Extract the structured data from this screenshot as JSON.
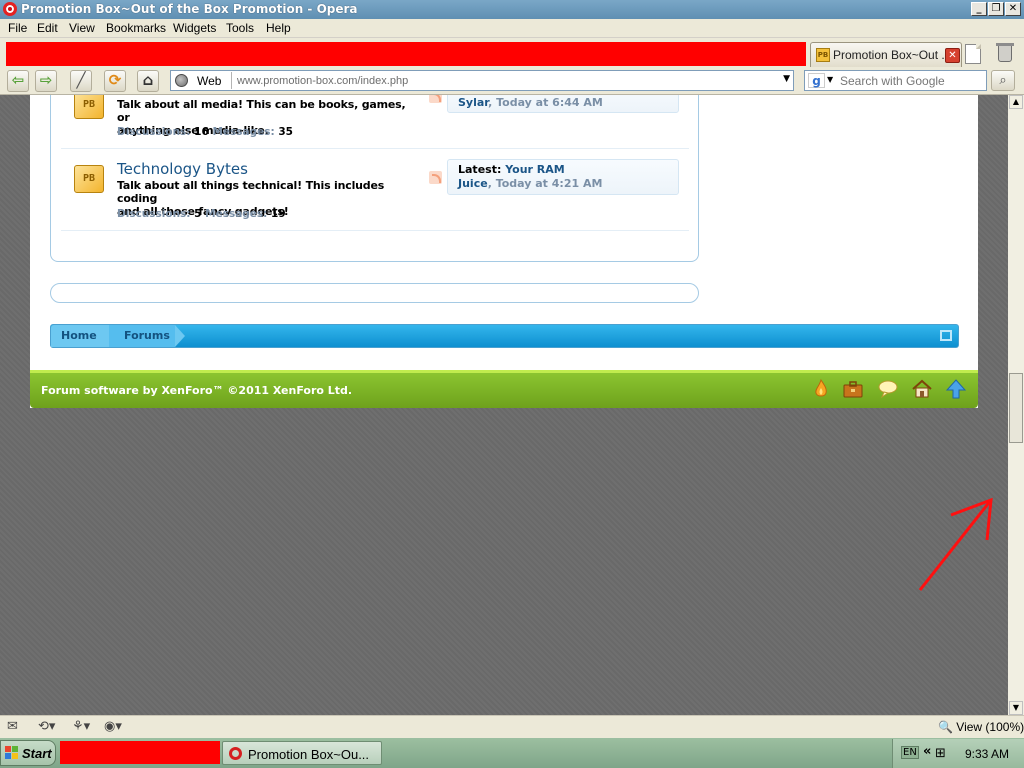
{
  "window": {
    "title": "Promotion Box~Out of the Box Promotion - Opera",
    "controls": [
      "_",
      "❐",
      "✕"
    ]
  },
  "menu": [
    "File",
    "Edit",
    "View",
    "Bookmarks",
    "Widgets",
    "Tools",
    "Help"
  ],
  "tab": {
    "label": "Promotion Box~Out ...",
    "favicon": "PB",
    "close": "✕"
  },
  "address": {
    "mode_label": "Web",
    "url": "www.promotion-box.com/index.php"
  },
  "search": {
    "placeholder": "Search with Google",
    "engine_logo": "g"
  },
  "forum": {
    "nodes": [
      {
        "icon_text": "PB",
        "title": "",
        "description_line1": "Talk about all media! This can be books, games, or",
        "description_line2": "anything else media-like.",
        "discussions_label": "Discussions:",
        "discussions": "16",
        "messages_label": "Messages:",
        "messages": "35",
        "latest_title": "",
        "latest_user": "Sylar",
        "latest_time": ", Today at 6:44 AM"
      },
      {
        "icon_text": "PB",
        "title": "Technology Bytes",
        "description_line1": "Talk about all things technical! This includes coding",
        "description_line2": "and all those fancy gadgets!",
        "discussions_label": "Discussions:",
        "discussions": "5",
        "messages_label": "Messages:",
        "messages": "19",
        "latest_label": "Latest:",
        "latest_title": "Your RAM",
        "latest_user": "Juice",
        "latest_time": ", Today at 4:21 AM"
      }
    ],
    "breadcrumb": [
      "Home",
      "Forums"
    ],
    "footer_text": "Forum software by XenForo™ ©2011 XenForo Ltd.",
    "footer_icons": [
      "flame-icon",
      "briefcase-icon",
      "chat-bubble-icon",
      "home-icon",
      "up-arrow-icon"
    ]
  },
  "statusbar": {
    "zoom": "View (100%)"
  },
  "taskbar": {
    "start": "Start",
    "task_label": "Promotion Box~Ou...",
    "lang": "EN",
    "chevron": "«",
    "clock": "9:33 AM"
  },
  "colors": {
    "accent_red": "#ff0000",
    "link_blue": "#1b5587",
    "footer_green": "#8bc530",
    "breadcrumb_blue": "#1ca2e0"
  }
}
